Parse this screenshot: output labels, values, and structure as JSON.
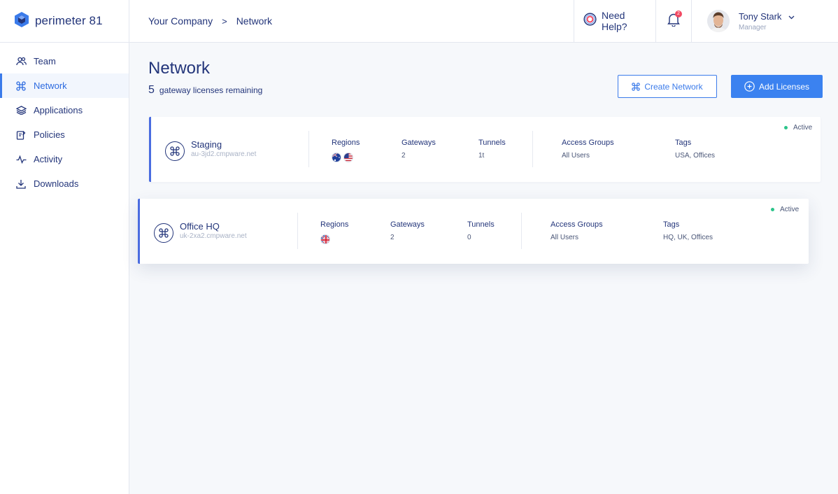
{
  "app": {
    "brand": "perimeter 81"
  },
  "sidebar": {
    "items": [
      {
        "label": "Team",
        "icon": "team-icon"
      },
      {
        "label": "Network",
        "icon": "network-icon",
        "active": true
      },
      {
        "label": "Applications",
        "icon": "applications-icon"
      },
      {
        "label": "Policies",
        "icon": "policies-icon"
      },
      {
        "label": "Activity",
        "icon": "activity-icon"
      },
      {
        "label": "Downloads",
        "icon": "downloads-icon"
      }
    ]
  },
  "header": {
    "breadcrumb": [
      "Your Company",
      "Network"
    ],
    "separator": ">",
    "help_label": "Need Help?",
    "notification_count": "2",
    "user": {
      "name": "Tony Stark",
      "role": "Manager"
    }
  },
  "main": {
    "title": "Network",
    "licenses_count": "5",
    "licenses_text": "gateway licenses remaining",
    "create_label": "Create Network",
    "add_label": "Add Licenses"
  },
  "networks": [
    {
      "name": "Staging",
      "host": "au-3jd2.cmpware.net",
      "status": "Active",
      "regions_label": "Regions",
      "regions": [
        "AU",
        "US"
      ],
      "gateways_label": "Gateways",
      "gateways": "2",
      "tunnels_label": "Tunnels",
      "tunnels": "1t",
      "access_label": "Access Groups",
      "access": "All Users",
      "tags_label": "Tags",
      "tags": "USA, Offices"
    },
    {
      "name": "Office HQ",
      "host": "uk-2xa2.cmpware.net",
      "status": "Active",
      "regions_label": "Regions",
      "regions": [
        "UK"
      ],
      "gateways_label": "Gateways",
      "gateways": "2",
      "tunnels_label": "Tunnels",
      "tunnels": "0",
      "access_label": "Access Groups",
      "access": "All Users",
      "tags_label": "Tags",
      "tags": "HQ, UK, Offices"
    }
  ],
  "colors": {
    "accent": "#3b82f0",
    "navy": "#23357a",
    "status_active": "#2bc48a",
    "badge": "#f24a63"
  }
}
